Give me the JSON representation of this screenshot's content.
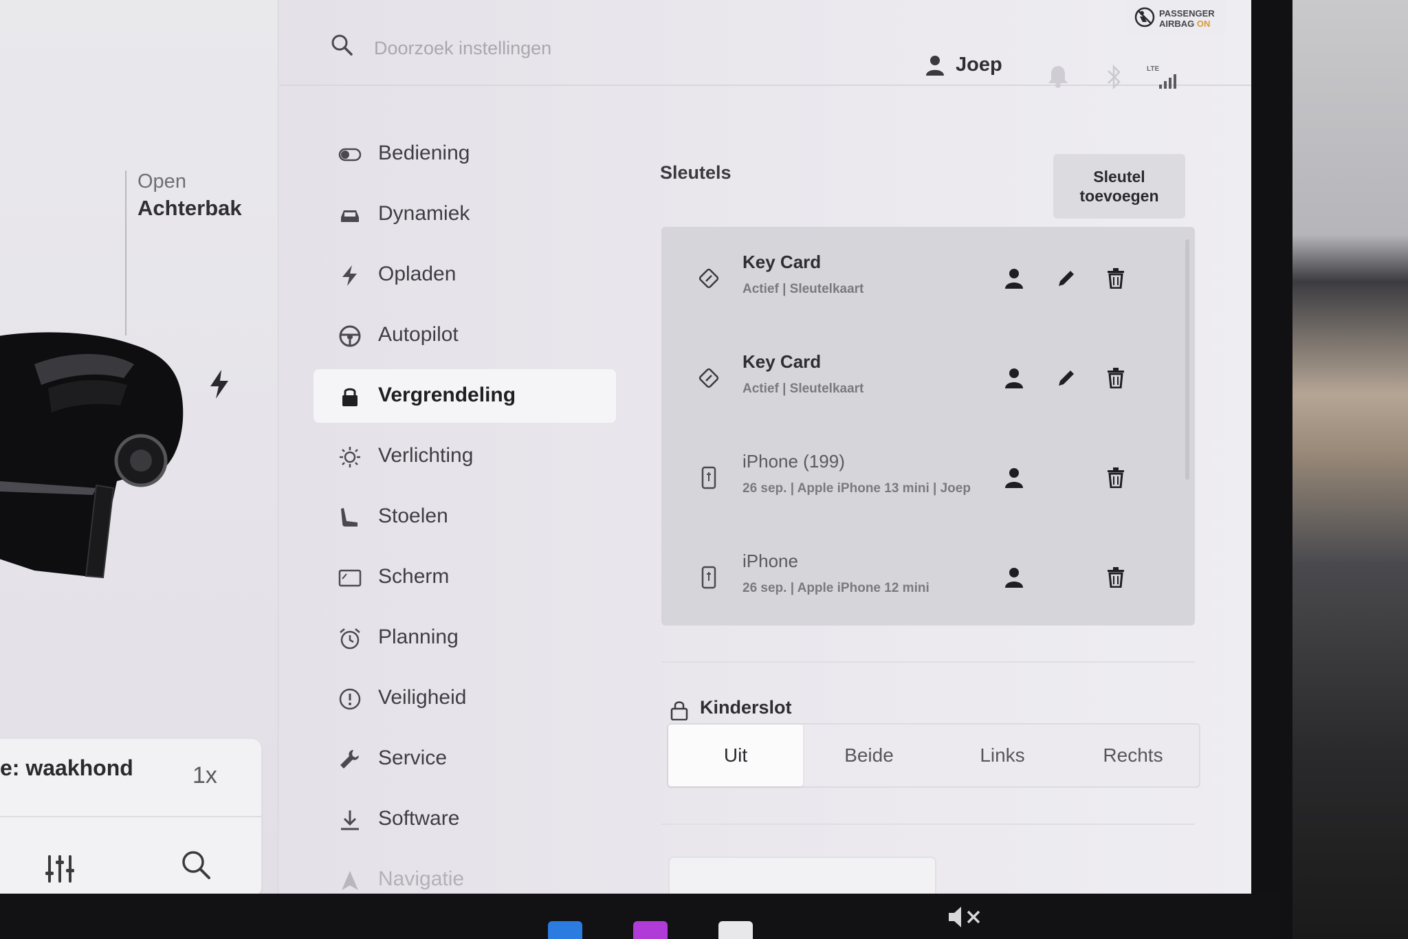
{
  "left_panel": {
    "trunk": {
      "line1": "Open",
      "line2": "Achterbak"
    },
    "media": {
      "title": "e: waakhond",
      "rate": "1x"
    }
  },
  "topbar": {
    "search_placeholder": "Doorzoek instellingen",
    "user_name": "Joep",
    "network": "LTE",
    "airbag": {
      "line1": "PASSENGER",
      "line2_prefix": "AIRBAG ",
      "line2_status": "ON"
    }
  },
  "nav": {
    "items": [
      {
        "label": "Bediening",
        "icon": "toggle-icon"
      },
      {
        "label": "Dynamiek",
        "icon": "car-icon"
      },
      {
        "label": "Opladen",
        "icon": "bolt-icon"
      },
      {
        "label": "Autopilot",
        "icon": "steering-wheel-icon"
      },
      {
        "label": "Vergrendeling",
        "icon": "lock-icon",
        "active": true
      },
      {
        "label": "Verlichting",
        "icon": "light-icon"
      },
      {
        "label": "Stoelen",
        "icon": "seat-icon"
      },
      {
        "label": "Scherm",
        "icon": "display-icon"
      },
      {
        "label": "Planning",
        "icon": "alarm-clock-icon"
      },
      {
        "label": "Veiligheid",
        "icon": "alert-circle-icon"
      },
      {
        "label": "Service",
        "icon": "wrench-icon"
      },
      {
        "label": "Software",
        "icon": "download-icon"
      },
      {
        "label": "Navigatie",
        "icon": "navigation-icon"
      }
    ]
  },
  "keys": {
    "title": "Sleutels",
    "add_button": "Sleutel\ntoevoegen",
    "items": [
      {
        "name": "Key Card",
        "subtitle": "Actief | Sleutelkaart",
        "type": "card",
        "editable": true
      },
      {
        "name": "Key Card",
        "subtitle": "Actief | Sleutelkaart",
        "type": "card",
        "editable": true
      },
      {
        "name": "iPhone (199)",
        "subtitle": "26 sep. | Apple iPhone 13 mini | Joep",
        "type": "phone",
        "editable": false
      },
      {
        "name": "iPhone",
        "subtitle": "26 sep. | Apple iPhone 12 mini",
        "type": "phone",
        "editable": false
      }
    ]
  },
  "child_lock": {
    "title": "Kinderslot",
    "options": [
      "Uit",
      "Beide",
      "Links",
      "Rechts"
    ],
    "selected": "Uit"
  },
  "colors": {
    "screen_bg": "#e4e3e8",
    "active_nav": "#f5f4f7",
    "airbag_on": "#d99a3a"
  }
}
